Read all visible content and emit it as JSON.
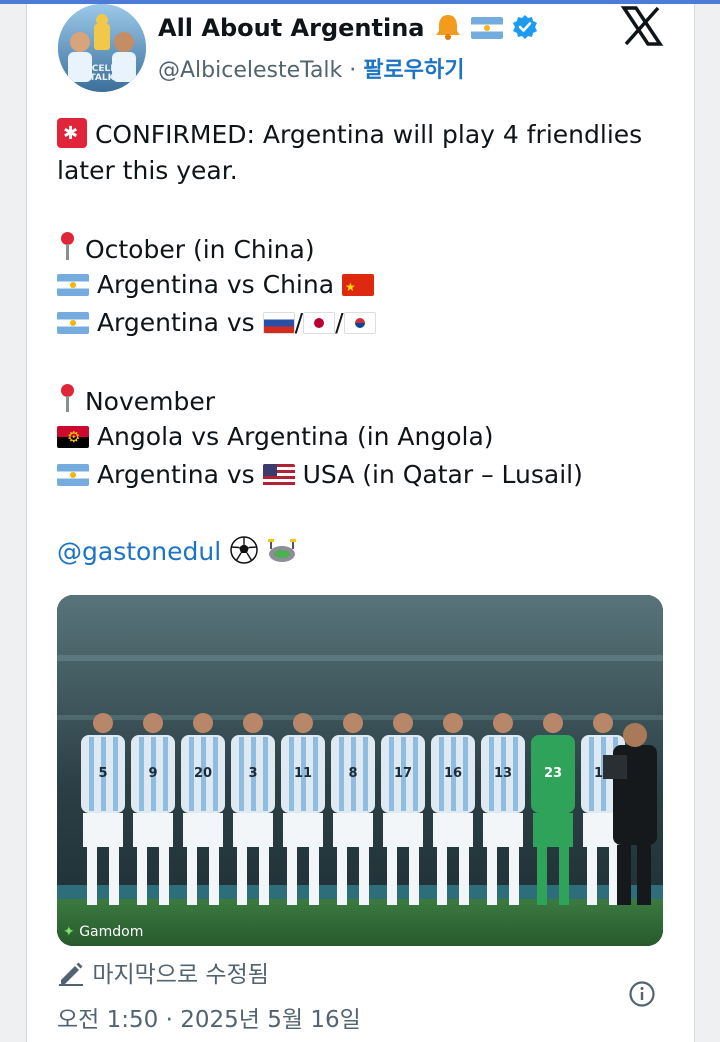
{
  "author": {
    "display_name": "All About Argentina",
    "handle": "@AlbicelesteTalk",
    "separator": "·",
    "follow_label": "팔로우하기",
    "avatar_text": "ALBICELESTE TALK",
    "verified_icon": "verified-badge-icon",
    "badge_icons": [
      "bell-icon",
      "argentina-flag-icon"
    ]
  },
  "tweet": {
    "line1": "CONFIRMED: Argentina will play 4 friendlies",
    "line2": "later this year.",
    "october_header": "October (in China)",
    "oct_match1": "Argentina vs China",
    "oct_match2": "Argentina vs",
    "oct_slash": "/",
    "november_header": "November",
    "nov_match1": "Angola vs Argentina (in Angola)",
    "nov_match2_prefix": "Argentina vs",
    "nov_match2_suffix": "USA (in Qatar – Lusail)",
    "mention": "@gastonedul"
  },
  "media": {
    "watermark": "Gamdom",
    "jersey_numbers": [
      "5",
      "9",
      "20",
      "3",
      "11",
      "8",
      "17",
      "16",
      "13",
      "23",
      "19"
    ]
  },
  "footer": {
    "edited_label": "마지막으로 수정됨",
    "timestamp": "오전 1:50 · 2025년 5월 16일"
  },
  "colors": {
    "link": "#1d74c4",
    "muted": "#536471",
    "argentina_sky": "#74acdf",
    "pitch": "#2f6b3a",
    "keeper_green": "#2fa35a"
  }
}
